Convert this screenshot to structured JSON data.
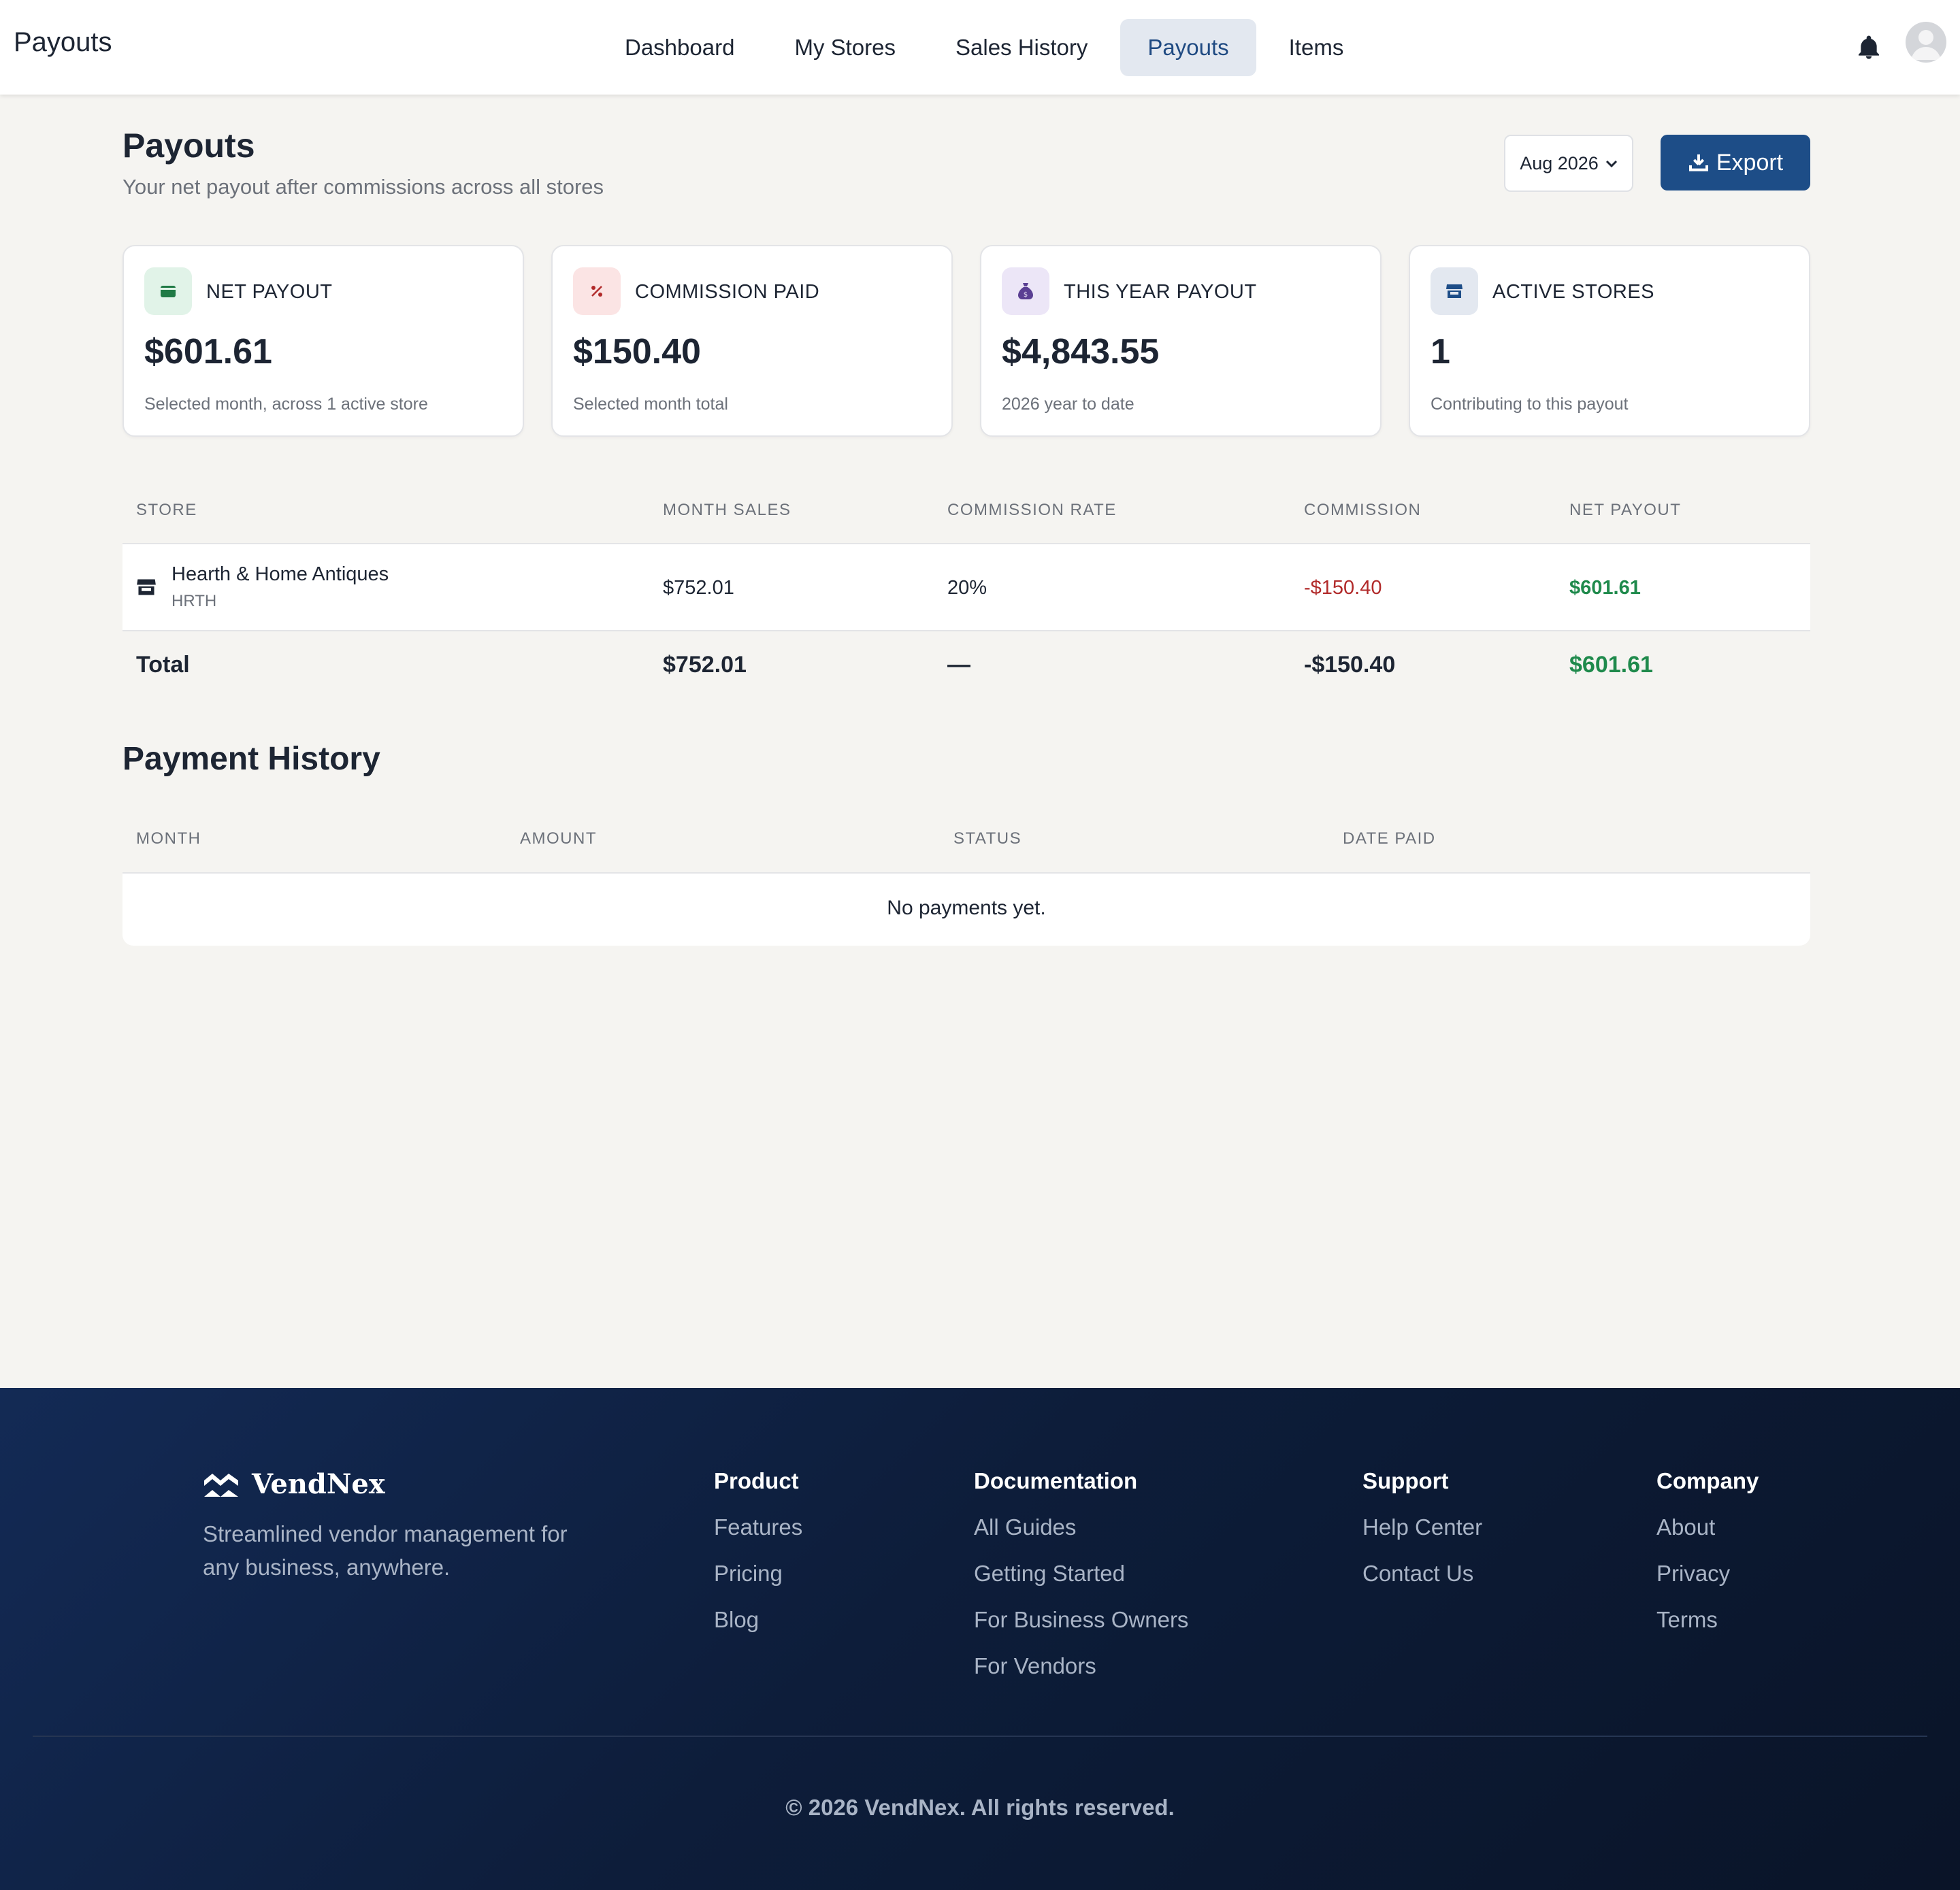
{
  "header": {
    "title": "Payouts",
    "nav": [
      {
        "label": "Dashboard",
        "active": false
      },
      {
        "label": "My Stores",
        "active": false
      },
      {
        "label": "Sales History",
        "active": false
      },
      {
        "label": "Payouts",
        "active": true
      },
      {
        "label": "Items",
        "active": false
      }
    ],
    "icons": [
      "bell-icon",
      "avatar"
    ]
  },
  "page": {
    "title": "Payouts",
    "subtitle": "Your net payout after commissions across all stores",
    "month_select": "Aug 2026",
    "export_label": "Export"
  },
  "stats": [
    {
      "icon": "wallet-icon",
      "label": "NET PAYOUT",
      "value": "$601.61",
      "note": "Selected month, across 1 active store",
      "icon_bg": "#e1f3e8",
      "icon_color": "#1f7a45"
    },
    {
      "icon": "percent-icon",
      "label": "COMMISSION PAID",
      "value": "$150.40",
      "note": "Selected month total",
      "icon_bg": "#fbe4e4",
      "icon_color": "#b12a2a"
    },
    {
      "icon": "money-bag-icon",
      "label": "THIS YEAR PAYOUT",
      "value": "$4,843.55",
      "note": "2026 year to date",
      "icon_bg": "#ece6f7",
      "icon_color": "#5a3f93"
    },
    {
      "icon": "store-icon",
      "label": "ACTIVE STORES",
      "value": "1",
      "note": "Contributing to this payout",
      "icon_bg": "#e3e8f0",
      "icon_color": "#1d4d87"
    }
  ],
  "stores_table": {
    "columns": [
      "STORE",
      "MONTH SALES",
      "COMMISSION RATE",
      "COMMISSION",
      "NET PAYOUT"
    ],
    "rows": [
      {
        "store": "Hearth & Home Antiques",
        "code": "HRTH",
        "month_sales": "$752.01",
        "rate": "20%",
        "commission": "-$150.40",
        "net": "$601.61"
      }
    ],
    "total": {
      "label": "Total",
      "month_sales": "$752.01",
      "rate": "—",
      "commission": "-$150.40",
      "net": "$601.61"
    }
  },
  "payment_history": {
    "title": "Payment History",
    "columns": [
      "MONTH",
      "AMOUNT",
      "STATUS",
      "DATE PAID"
    ],
    "empty": "No payments yet."
  },
  "footer": {
    "brand": "VendNex",
    "tagline": "Streamlined vendor management for any business, anywhere.",
    "columns": [
      {
        "heading": "Product",
        "links": [
          "Features",
          "Pricing",
          "Blog"
        ]
      },
      {
        "heading": "Documentation",
        "links": [
          "All Guides",
          "Getting Started",
          "For Business Owners",
          "For Vendors"
        ]
      },
      {
        "heading": "Support",
        "links": [
          "Help Center",
          "Contact Us"
        ]
      },
      {
        "heading": "Company",
        "links": [
          "About",
          "Privacy",
          "Terms"
        ]
      }
    ],
    "copyright": "© 2026 VendNex. All rights reserved."
  },
  "colors": {
    "primary": "#1d4d87",
    "negative": "#b12a2a",
    "positive": "#1f8a4c",
    "footer_bg": "#0d1d3a"
  }
}
